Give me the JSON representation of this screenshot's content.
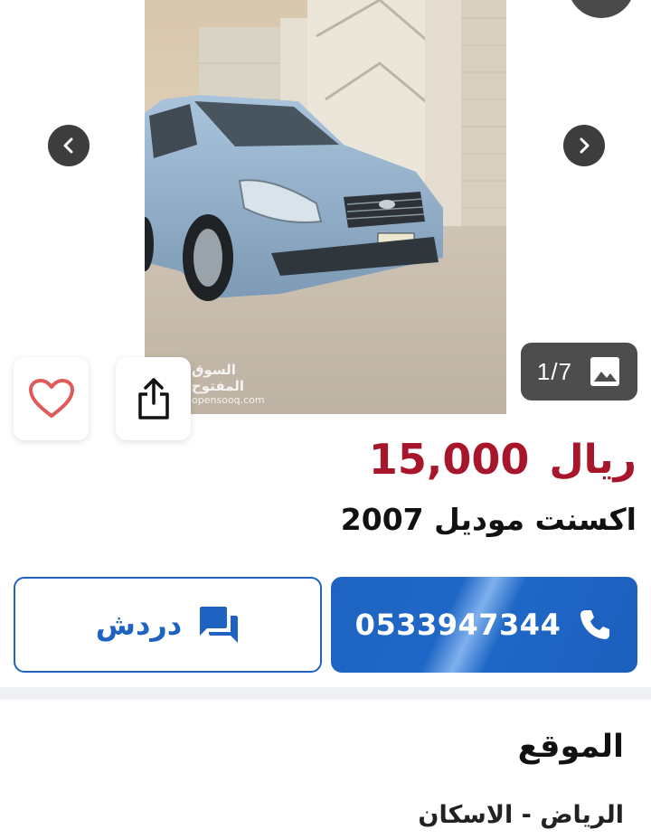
{
  "gallery": {
    "watermark_ar": "السوق المفتوح",
    "watermark_en": "opensooq.com",
    "counter": "1/7",
    "icons": {
      "prev": "chevron-left-icon",
      "next": "chevron-right-icon",
      "gallery": "image-icon",
      "favorite": "heart-icon",
      "share": "share-icon"
    }
  },
  "listing": {
    "price_value": "15,000",
    "price_currency": "ريال",
    "title": "اكسنت موديل 2007"
  },
  "actions": {
    "phone": "0533947344",
    "chat_label": "دردش",
    "phone_icon": "phone-icon",
    "chat_icon": "chat-icon"
  },
  "location": {
    "heading": "الموقع",
    "value": "الرياض - الاسكان"
  },
  "colors": {
    "price": "#a8162b",
    "primary": "#1e63c2",
    "overlay": "#4d4d4d"
  }
}
